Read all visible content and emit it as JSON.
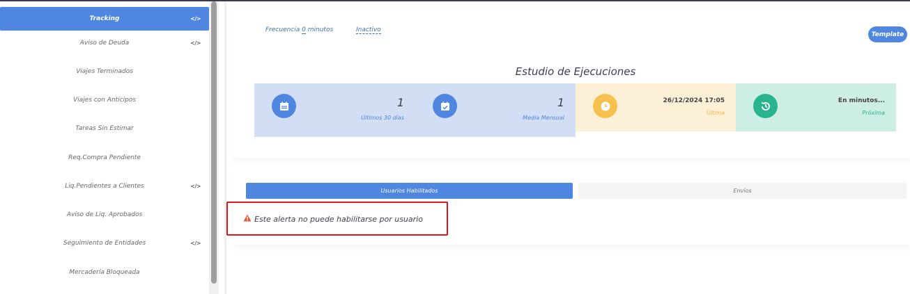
{
  "sidebar": {
    "items": [
      {
        "label": "Tracking",
        "active": true,
        "code_icon": true
      },
      {
        "label": "Aviso de Deuda",
        "active": false,
        "code_icon": true
      },
      {
        "label": "Viajes Terminados",
        "active": false,
        "code_icon": false
      },
      {
        "label": "Viajes con Anticipos",
        "active": false,
        "code_icon": false
      },
      {
        "label": "Tareas Sin Estimar",
        "active": false,
        "code_icon": false
      },
      {
        "label": "Req.Compra Pendiente",
        "active": false,
        "code_icon": false
      },
      {
        "label": "Liq.Pendientes a Clientes",
        "active": false,
        "code_icon": true
      },
      {
        "label": "Aviso de Liq. Aprobados",
        "active": false,
        "code_icon": false
      },
      {
        "label": "Seguimiento de Entidades",
        "active": false,
        "code_icon": true
      },
      {
        "label": "Mercadería Bloqueada",
        "active": false,
        "code_icon": false
      }
    ],
    "code_icon_glyph": "</>"
  },
  "header": {
    "frequency_prefix": "Frecuencia ",
    "frequency_value": "0",
    "frequency_suffix": " minutos",
    "status_label": "Inactivo",
    "template_button": "Template"
  },
  "stats": {
    "title": "Estudio de Ejecuciones",
    "cards": [
      {
        "value": "1",
        "label": "Últimos 30 días",
        "icon": "calendar-icon",
        "bg": "#d2def4",
        "circle": "#4f86df",
        "label_color": "#4f86df"
      },
      {
        "value": "1",
        "label": "Media Mensual",
        "icon": "calendar-check-icon",
        "bg": "#d2def4",
        "circle": "#4f86df",
        "label_color": "#4f86df"
      },
      {
        "value": "26/12/2024 17:05",
        "label": "Última",
        "icon": "clock-icon",
        "bg": "#fcf0d6",
        "circle": "#f7c14f",
        "label_color": "#f0b44a"
      },
      {
        "value": "En minutos...",
        "label": "Próxima",
        "icon": "history-icon",
        "bg": "#cdeee4",
        "circle": "#27b48f",
        "label_color": "#27b48f"
      }
    ]
  },
  "tabs": [
    {
      "label": "Usuarios Habilitados",
      "active": true
    },
    {
      "label": "Envíos",
      "active": false
    }
  ],
  "alert": {
    "icon": "warning-icon",
    "icon_color": "#e15a3a",
    "message": "Este alerta no puede habilitarse por usuario"
  }
}
